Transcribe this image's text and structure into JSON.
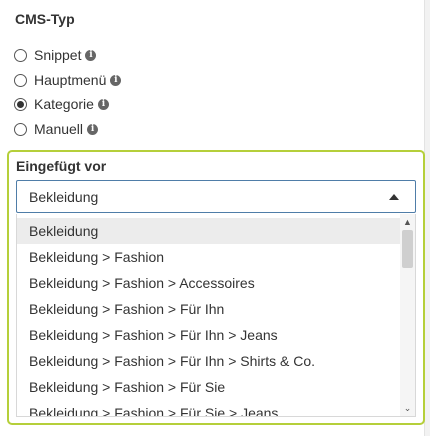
{
  "cms_type": {
    "title": "CMS-Typ",
    "options": [
      {
        "label": "Snippet",
        "checked": false,
        "info_icon": "info-icon"
      },
      {
        "label": "Hauptmenü",
        "checked": false,
        "info_icon": "info-icon"
      },
      {
        "label": "Kategorie",
        "checked": true,
        "info_icon": "info-icon"
      },
      {
        "label": "Manuell",
        "checked": false,
        "info_icon": "info-icon"
      }
    ]
  },
  "insert_before": {
    "title": "Eingefügt vor",
    "selected_value": "Bekleidung",
    "options": [
      "Bekleidung",
      "Bekleidung > Fashion",
      "Bekleidung > Fashion > Accessoires",
      "Bekleidung > Fashion > Für Ihn",
      "Bekleidung > Fashion > Für Ihn > Jeans",
      "Bekleidung > Fashion > Für Ihn > Shirts & Co.",
      "Bekleidung > Fashion > Für Sie",
      "Bekleidung > Fashion > Für Sie > Jeans"
    ],
    "highlighted_index": 0
  },
  "colors": {
    "panel_border": "#b5cf3a",
    "select_border": "#4f7da8",
    "highlight": "#ececec"
  }
}
